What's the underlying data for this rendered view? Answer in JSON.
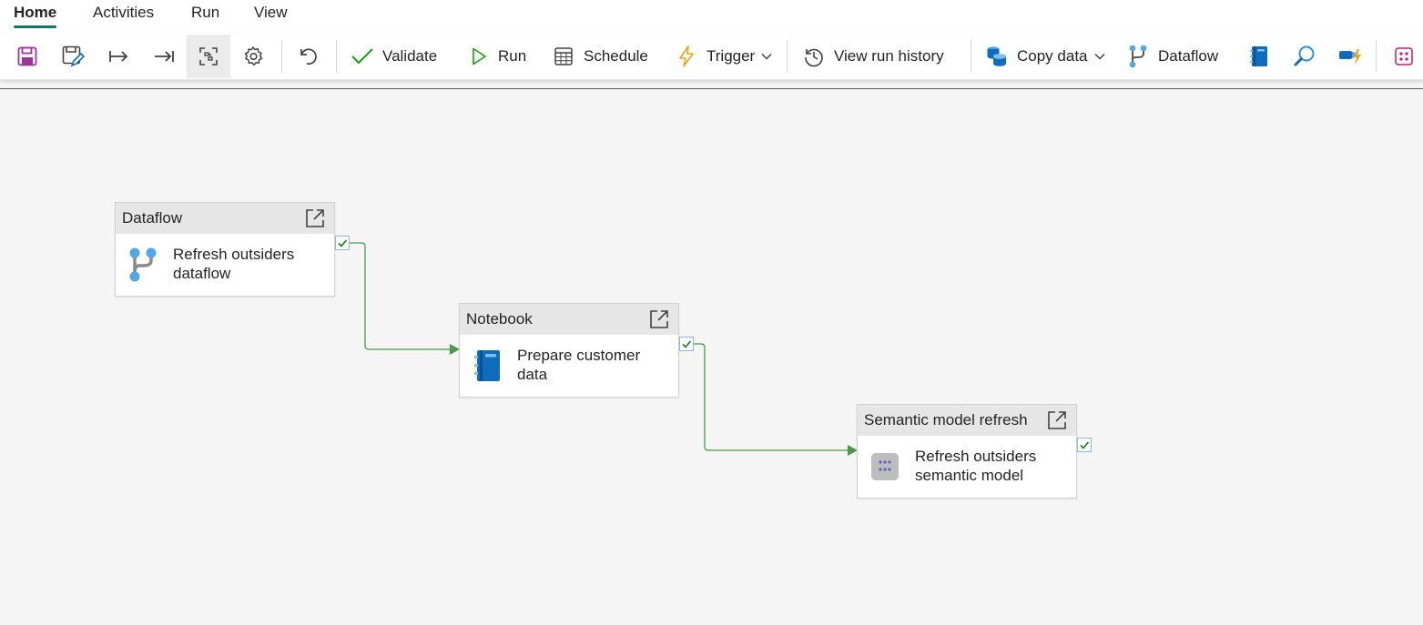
{
  "tabs": [
    {
      "label": "Home",
      "active": true
    },
    {
      "label": "Activities",
      "active": false
    },
    {
      "label": "Run",
      "active": false
    },
    {
      "label": "View",
      "active": false
    }
  ],
  "toolbar": {
    "validate_label": "Validate",
    "run_label": "Run",
    "schedule_label": "Schedule",
    "trigger_label": "Trigger",
    "view_run_history_label": "View run history",
    "copy_data_label": "Copy data",
    "dataflow_label": "Dataflow",
    "icons": [
      "save-icon",
      "save-as-icon",
      "export-icon",
      "import-icon",
      "auto-align-icon",
      "gear-icon",
      "undo-icon",
      "checkmark-icon",
      "play-icon",
      "calendar-icon",
      "lightning-icon",
      "history-icon",
      "database-icon",
      "dataflow-icon",
      "notebook-icon",
      "lookup-icon",
      "pipeline-icon",
      "apps-icon"
    ]
  },
  "activities": [
    {
      "type": "Dataflow",
      "name": "Refresh outsiders dataflow",
      "icon": "dataflow-icon",
      "status": "succeeded"
    },
    {
      "type": "Notebook",
      "name": "Prepare customer data",
      "icon": "notebook-icon",
      "status": "succeeded"
    },
    {
      "type": "Semantic model refresh",
      "name": "Refresh outsiders semantic model",
      "icon": "semantic-model-icon",
      "status": "succeeded"
    }
  ],
  "colors": {
    "accent": "#117865",
    "connector": "#4a9a4a",
    "dataflow_blue": "#4fa8e8",
    "notebook_blue": "#0f6cbd",
    "save_purple": "#a0339a"
  }
}
